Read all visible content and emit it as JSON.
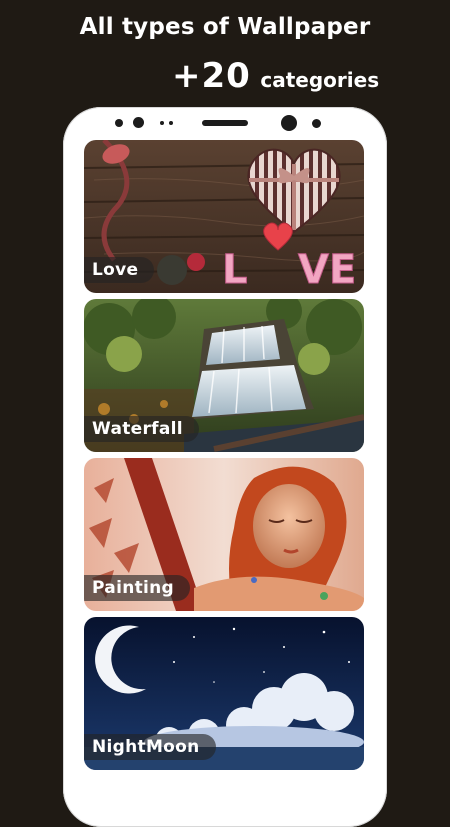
{
  "header": {
    "title": "All types of Wallpaper",
    "count": "+20",
    "count_label": "categories"
  },
  "categories": [
    {
      "label": "Love",
      "icon": "heart-gift-box-icon"
    },
    {
      "label": "Waterfall",
      "icon": "waterfall-icon"
    },
    {
      "label": "Painting",
      "icon": "painting-icon"
    },
    {
      "label": "NightMoon",
      "icon": "moon-icon"
    }
  ],
  "colors": {
    "background": "#1f1a14",
    "phone_frame": "#ffffff",
    "label_pill": "rgba(35,35,35,0.62)"
  }
}
